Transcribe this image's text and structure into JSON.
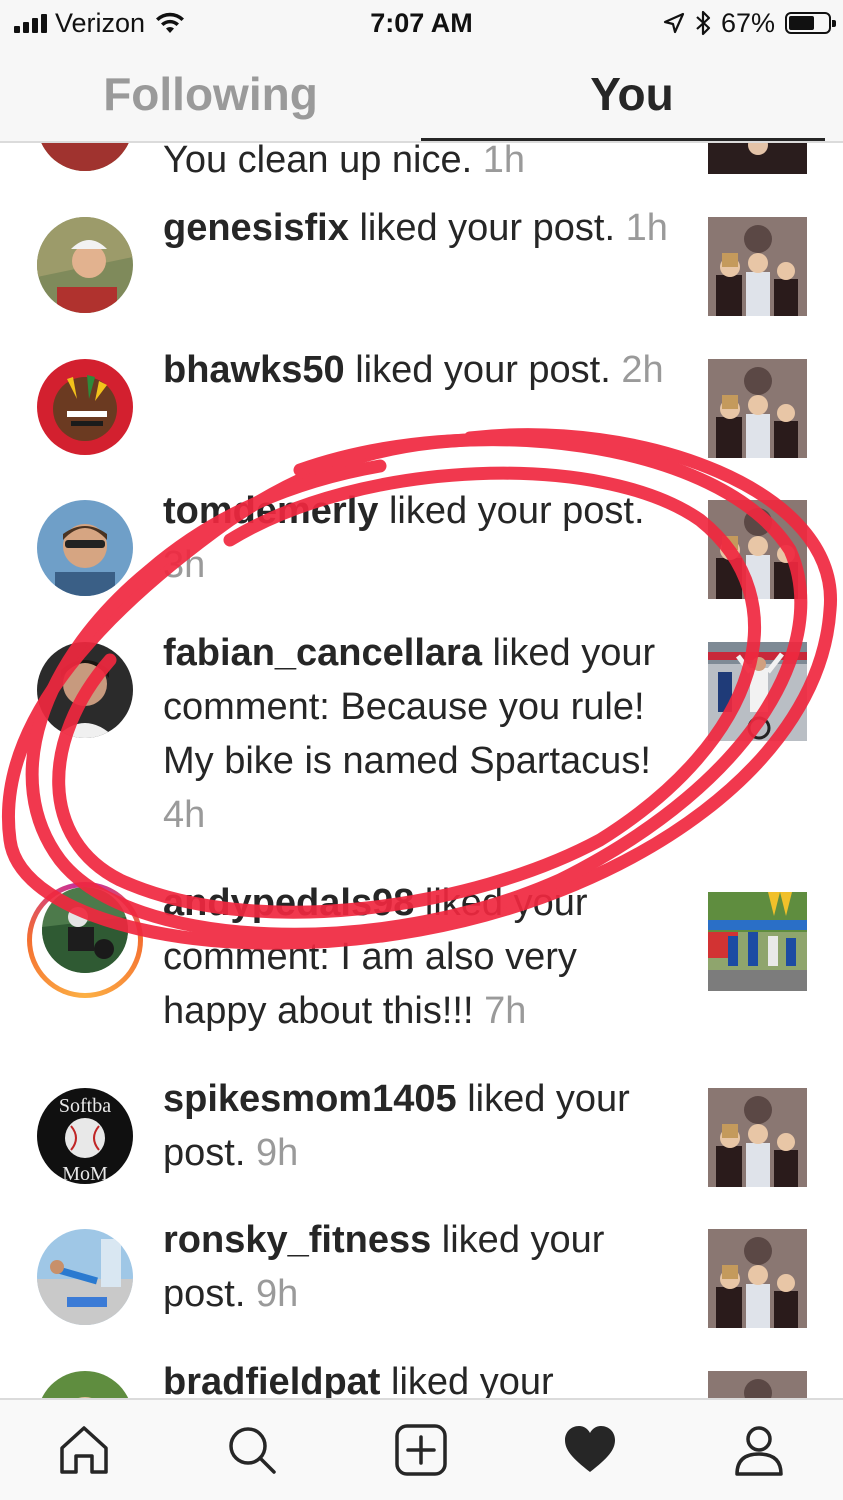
{
  "status_bar": {
    "carrier": "Verizon",
    "time": "7:07 AM",
    "battery_percent": "67%",
    "battery_level": 0.67,
    "icons": [
      "signal-icon",
      "wifi-icon",
      "location-icon",
      "bluetooth-icon",
      "battery-icon"
    ]
  },
  "tabs": [
    {
      "label": "Following",
      "active": false
    },
    {
      "label": "You",
      "active": true
    }
  ],
  "notifications": [
    {
      "user": "",
      "action": "You clean up nice.",
      "time": "1h"
    },
    {
      "user": "genesisfix",
      "action": "liked your post.",
      "time": "1h"
    },
    {
      "user": "bhawks50",
      "action": "liked your post.",
      "time": "2h"
    },
    {
      "user": "tomdemerly",
      "action": "liked your post.",
      "time": "3h"
    },
    {
      "user": "fabian_cancellara",
      "action": "liked your comment: Because you rule! My bike is named Spartacus!",
      "time": "4h"
    },
    {
      "user": "andypedals98",
      "action": "liked your comment: I am also very happy about this!!!",
      "time": "7h"
    },
    {
      "user": "spikesmom1405",
      "action": "liked your post.",
      "time": "9h"
    },
    {
      "user": "ronsky_fitness",
      "action": "liked your post.",
      "time": "9h"
    },
    {
      "user": "bradfieldpat",
      "action": "liked your",
      "time": ""
    }
  ],
  "avatar_badges": {
    "softball_top": "Softba",
    "softball_bottom": "MoM"
  },
  "bottom_nav": [
    "home-icon",
    "search-icon",
    "new-post-icon",
    "activity-heart-icon",
    "profile-icon"
  ],
  "colors": {
    "marker_red": "#f0283f",
    "secondary_text": "#9a9a9a",
    "primary_text": "#262626"
  }
}
